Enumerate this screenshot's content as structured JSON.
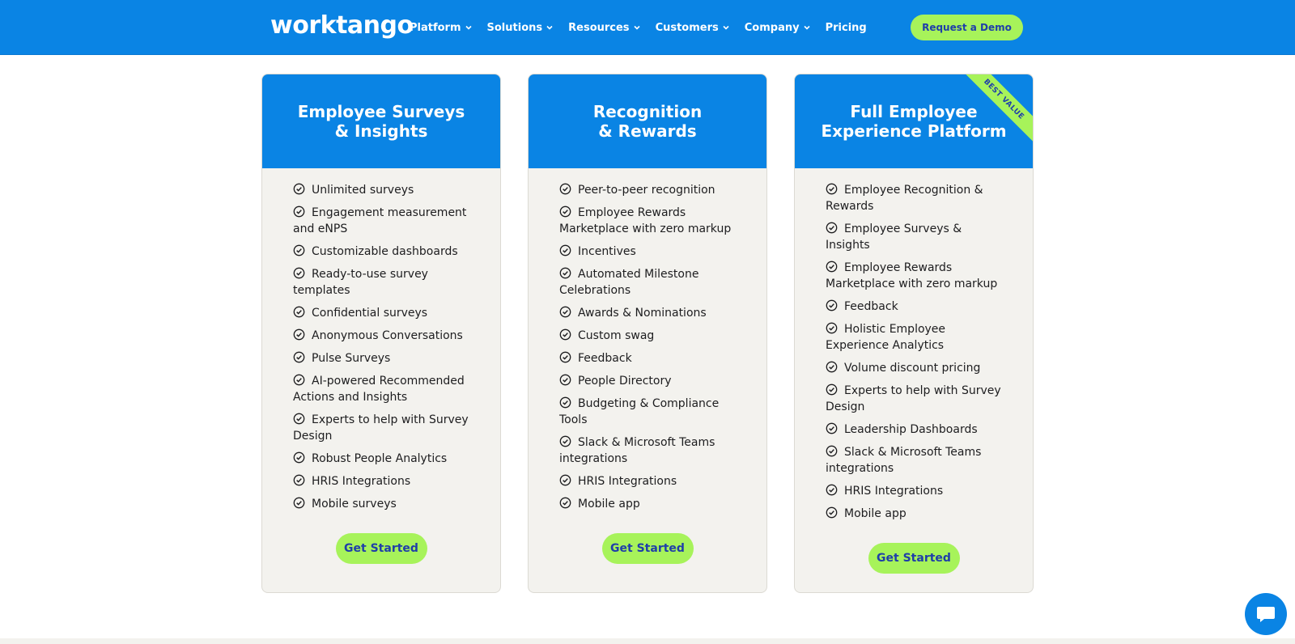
{
  "header": {
    "logo_text": "worktango",
    "nav": [
      "Platform",
      "Solutions",
      "Resources",
      "Customers",
      "Company",
      "Pricing"
    ],
    "cta": "Request a Demo"
  },
  "colors": {
    "brand_blue": "#0a84e4",
    "accent_green": "#a7f35a",
    "button_text": "#1f3ea9",
    "card_bg": "#f3f2ee"
  },
  "plans": [
    {
      "title_line1": "Employee Surveys",
      "title_line2": "& Insights",
      "badge": "",
      "features": [
        "Unlimited surveys",
        "Engagement measurement and eNPS",
        "Customizable dashboards",
        "Ready-to-use survey templates",
        "Confidential surveys",
        "Anonymous Conversations",
        "Pulse Surveys",
        "AI-powered Recommended Actions and Insights",
        "Experts to help with Survey Design",
        "Robust People Analytics",
        "HRIS Integrations",
        "Mobile surveys"
      ],
      "cta": "Get Started"
    },
    {
      "title_line1": "Recognition",
      "title_line2": "& Rewards",
      "badge": "",
      "features": [
        "Peer-to-peer recognition",
        "Employee Rewards Marketplace with zero markup",
        "Incentives",
        "Automated Milestone Celebrations",
        "Awards & Nominations",
        "Custom swag",
        "Feedback",
        "People Directory",
        "Budgeting & Compliance Tools",
        "Slack & Microsoft Teams integrations",
        "HRIS Integrations",
        "Mobile app"
      ],
      "cta": "Get Started"
    },
    {
      "title_line1": "Full Employee",
      "title_line2": "Experience Platform",
      "badge": "BEST VALUE",
      "features": [
        "Employee Recognition & Rewards",
        "Employee Surveys & Insights",
        "Employee Rewards Marketplace with zero markup",
        "Feedback",
        "Holistic Employee Experience Analytics",
        "Volume discount pricing",
        "Experts to help with Survey Design",
        "Leadership Dashboards",
        "Slack & Microsoft Teams integrations",
        "HRIS Integrations",
        "Mobile app"
      ],
      "cta": "Get Started"
    }
  ],
  "icons": {
    "check": "check-circle-icon",
    "chevron": "chevron-down-icon",
    "chat": "chat-bubble-icon"
  }
}
